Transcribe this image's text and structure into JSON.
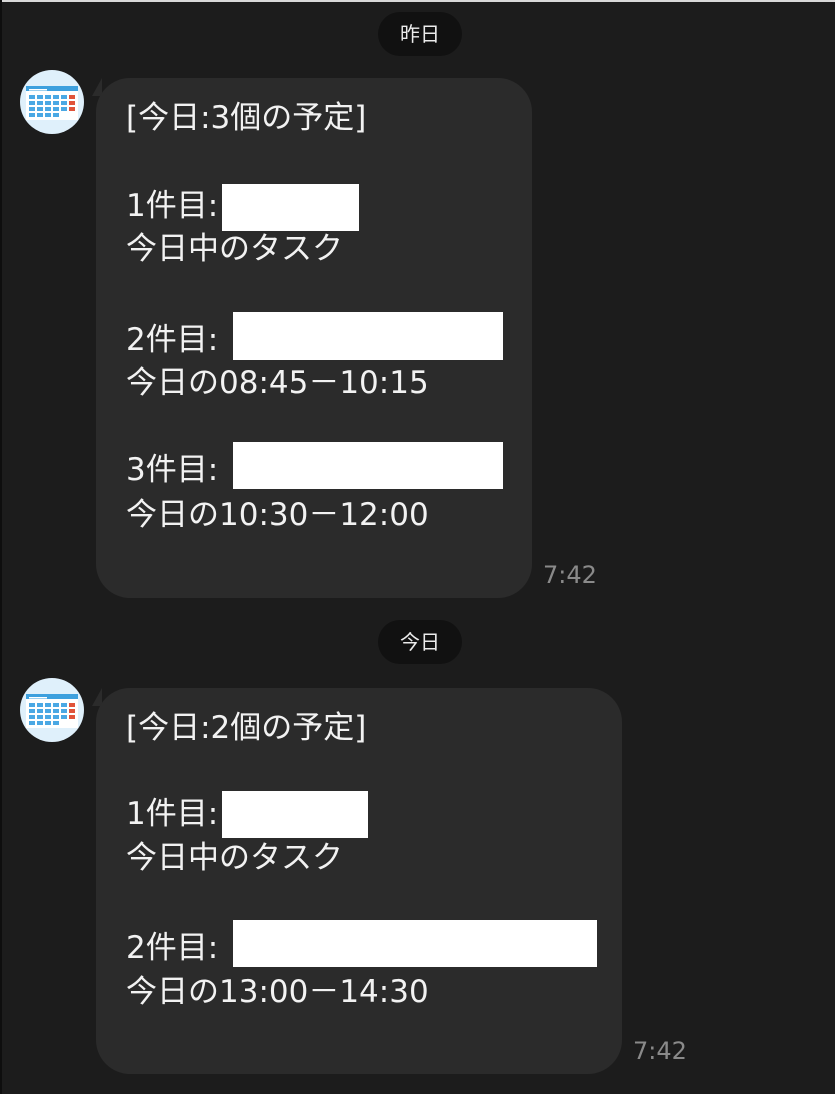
{
  "colors": {
    "background": "#1c1c1c",
    "bubble": "#2b2b2b",
    "date_pill": "#111111",
    "text": "#f2f2f2",
    "time": "#8a8a8a",
    "redaction": "#ffffff"
  },
  "messages": [
    {
      "date_label": "昨日",
      "lines": [
        "[今日:3個の予定]",
        "1件目:",
        "今日中のタスク",
        "2件目:",
        "今日の08:45－10:15",
        "3件目:",
        "今日の10:30－12:00"
      ],
      "time": "7:42"
    },
    {
      "date_label": "今日",
      "lines": [
        "[今日:2個の予定]",
        "1件目:",
        "今日中のタスク",
        "2件目:",
        "今日の13:00－14:30"
      ],
      "time": "7:42"
    }
  ],
  "icons": {
    "avatar": "calendar-icon"
  }
}
